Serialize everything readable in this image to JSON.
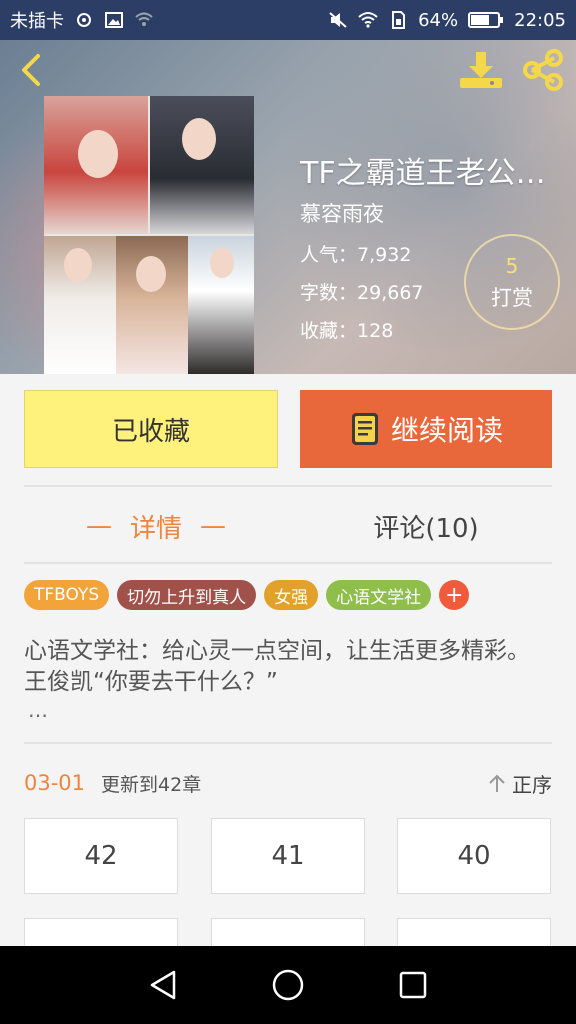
{
  "status_bar": {
    "carrier": "未插卡",
    "battery": "64%",
    "time": "22:05"
  },
  "book": {
    "title": "TF之霸道王老公…",
    "author": "慕容雨夜",
    "popularity_label": "人气：",
    "popularity_value": "7,932",
    "words_label": "字数：",
    "words_value": "29,667",
    "favorites_label": "收藏：",
    "favorites_value": "128"
  },
  "tip": {
    "count": "5",
    "label": "打赏"
  },
  "actions": {
    "favorited_label": "已收藏",
    "continue_label": "继续阅读"
  },
  "tabs": {
    "detail_label": "详情",
    "detail_dash": "—",
    "comments_label": "评论(10)"
  },
  "tags": [
    {
      "label": "TFBOYS",
      "color": "#f2a33a"
    },
    {
      "label": "切勿上升到真人",
      "color": "#a0524a"
    },
    {
      "label": "女强",
      "color": "#e2a12b"
    },
    {
      "label": "心语文学社",
      "color": "#8fbf4a"
    }
  ],
  "tag_add": "+",
  "description": "心语文学社：给心灵一点空间，让生活更多精彩。王俊凯“你要去干什么？”",
  "description_more": "…",
  "update": {
    "date": "03-01",
    "text": "更新到42章",
    "sort_label": "正序"
  },
  "chapters": [
    "42",
    "41",
    "40"
  ],
  "colors": {
    "accent_orange": "#e8683c",
    "favorite_yellow": "#fff27c",
    "tab_orange": "#f0843c"
  },
  "icons": [
    "back-icon",
    "download-icon",
    "share-icon",
    "book-icon",
    "arrow-up-icon",
    "nav-back-icon",
    "nav-home-icon",
    "nav-recent-icon"
  ]
}
